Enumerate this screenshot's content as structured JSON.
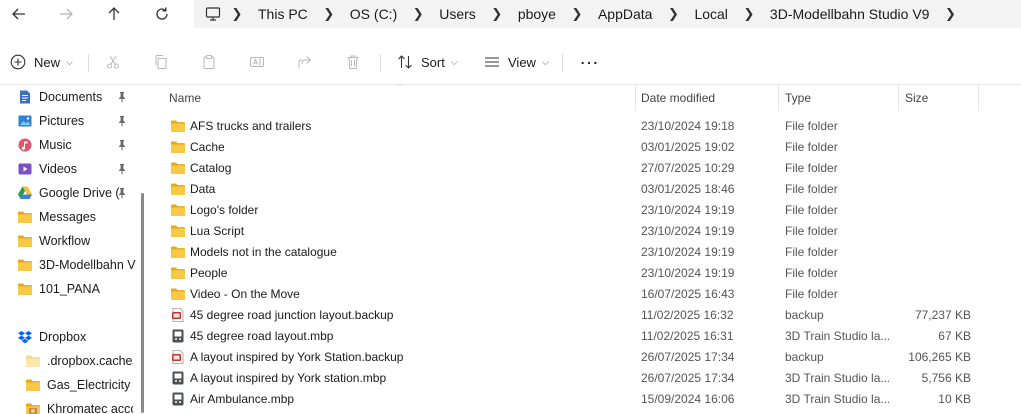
{
  "breadcrumb": [
    "This PC",
    "OS (C:)",
    "Users",
    "pboye",
    "AppData",
    "Local",
    "3D-Modellbahn Studio V9"
  ],
  "toolbar": {
    "new_label": "New",
    "sort_label": "Sort",
    "view_label": "View",
    "more_label": "…"
  },
  "sidebar": {
    "items": [
      {
        "label": "Documents",
        "icon": "documents-icon",
        "pinned": true
      },
      {
        "label": "Pictures",
        "icon": "pictures-icon",
        "pinned": true
      },
      {
        "label": "Music",
        "icon": "music-icon",
        "pinned": true
      },
      {
        "label": "Videos",
        "icon": "videos-icon",
        "pinned": true
      },
      {
        "label": "Google Drive (",
        "icon": "google-drive-icon",
        "pinned": true
      },
      {
        "label": "Messages",
        "icon": "folder-icon",
        "pinned": false
      },
      {
        "label": "Workflow",
        "icon": "folder-icon",
        "pinned": false
      },
      {
        "label": "3D-Modellbahn V",
        "icon": "folder-icon",
        "pinned": false
      },
      {
        "label": "101_PANA",
        "icon": "folder-icon",
        "pinned": false
      }
    ],
    "dropbox": {
      "label": "Dropbox",
      "icon": "dropbox-icon"
    },
    "dropbox_items": [
      {
        "label": ".dropbox.cache",
        "icon": "folder-light-icon"
      },
      {
        "label": "Gas_Electricity s",
        "icon": "folder-icon"
      },
      {
        "label": "Khromatec acco",
        "icon": "folder-image-icon"
      }
    ]
  },
  "columns": {
    "name": "Name",
    "date": "Date modified",
    "type": "Type",
    "size": "Size"
  },
  "files": [
    {
      "name": "AFS trucks and trailers",
      "date": "23/10/2024 19:18",
      "type": "File folder",
      "size": "",
      "icon": "folder-icon"
    },
    {
      "name": "Cache",
      "date": "03/01/2025 19:02",
      "type": "File folder",
      "size": "",
      "icon": "folder-icon"
    },
    {
      "name": "Catalog",
      "date": "27/07/2025 10:29",
      "type": "File folder",
      "size": "",
      "icon": "folder-icon"
    },
    {
      "name": "Data",
      "date": "03/01/2025 18:46",
      "type": "File folder",
      "size": "",
      "icon": "folder-icon"
    },
    {
      "name": "Logo's folder",
      "date": "23/10/2024 19:19",
      "type": "File folder",
      "size": "",
      "icon": "folder-icon"
    },
    {
      "name": "Lua Script",
      "date": "23/10/2024 19:19",
      "type": "File folder",
      "size": "",
      "icon": "folder-icon"
    },
    {
      "name": "Models not in the catalogue",
      "date": "23/10/2024 19:19",
      "type": "File folder",
      "size": "",
      "icon": "folder-icon"
    },
    {
      "name": "People",
      "date": "23/10/2024 19:19",
      "type": "File folder",
      "size": "",
      "icon": "folder-icon"
    },
    {
      "name": "Video - On the Move",
      "date": "16/07/2025 16:43",
      "type": "File folder",
      "size": "",
      "icon": "folder-icon"
    },
    {
      "name": "45 degree road junction layout.backup",
      "date": "11/02/2025 16:32",
      "type": "backup",
      "size": "77,237 KB",
      "icon": "backup-file-icon"
    },
    {
      "name": "45 degree road layout.mbp",
      "date": "11/02/2025 16:31",
      "type": "3D Train Studio la...",
      "size": "67 KB",
      "icon": "train-file-icon"
    },
    {
      "name": "A layout inspired by York Station.backup",
      "date": "26/07/2025 17:34",
      "type": "backup",
      "size": "106,265 KB",
      "icon": "backup-file-icon"
    },
    {
      "name": "A layout inspired by York station.mbp",
      "date": "26/07/2025 17:34",
      "type": "3D Train Studio la...",
      "size": "5,756 KB",
      "icon": "train-file-icon"
    },
    {
      "name": "Air Ambulance.mbp",
      "date": "15/09/2024 16:06",
      "type": "3D Train Studio la...",
      "size": "10 KB",
      "icon": "train-file-icon"
    }
  ],
  "colors": {
    "folder": "#f8c846",
    "accent": "#0067c0",
    "address_bg": "#f3f3f3"
  }
}
